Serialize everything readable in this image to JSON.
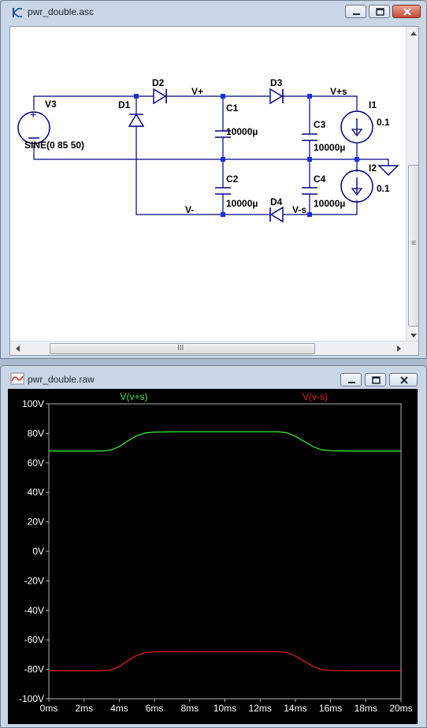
{
  "schematic_window": {
    "title": "pwr_double.asc",
    "controls": {
      "minimize": "minimize",
      "restore": "restore",
      "close": "close"
    },
    "labels": {
      "v3": "V3",
      "v3_value": "SINE(0 85 50)",
      "d1": "D1",
      "d2": "D2",
      "d3": "D3",
      "d4": "D4",
      "net_vplus": "V+",
      "net_vminus": "V-",
      "net_vplus_s": "V+s",
      "net_vminus_s": "V-s",
      "c1": "C1",
      "c1_value": "10000µ",
      "c2": "C2",
      "c2_value": "10000µ",
      "c3": "C3",
      "c3_value": "10000µ",
      "c4": "C4",
      "c4_value": "10000µ",
      "i1": "I1",
      "i1_value": "0.1",
      "i2": "I2",
      "i2_value": "0.1"
    },
    "hscroll_grip": "III",
    "vscroll_grip": "≡"
  },
  "waveform_window": {
    "title": "pwr_double.raw",
    "controls": {
      "minimize": "minimize",
      "restore": "restore",
      "close": "close"
    }
  },
  "chart_data": {
    "type": "line",
    "title": "",
    "xlabel": "",
    "ylabel": "",
    "xlim": [
      0,
      20
    ],
    "ylim": [
      -100,
      100
    ],
    "x_ticks": [
      "0ms",
      "2ms",
      "4ms",
      "6ms",
      "8ms",
      "10ms",
      "12ms",
      "14ms",
      "16ms",
      "18ms",
      "20ms"
    ],
    "y_ticks": [
      "100V",
      "80V",
      "60V",
      "40V",
      "20V",
      "0V",
      "-20V",
      "-40V",
      "-60V",
      "-80V",
      "-100V"
    ],
    "background": "#000000",
    "grid": false,
    "x": [
      0,
      1,
      2,
      3,
      3.5,
      4,
      4.5,
      5,
      5.5,
      6,
      7,
      8,
      9,
      10,
      11,
      12,
      13,
      13.5,
      14,
      14.5,
      15,
      15.5,
      16,
      17,
      18,
      19,
      20
    ],
    "series": [
      {
        "name": "V(v+s)",
        "color": "#39e639",
        "values": [
          68,
          68,
          68,
          68,
          68.5,
          71,
          75,
          78.5,
          80.3,
          80.8,
          81,
          81,
          81,
          81,
          81,
          81,
          81,
          80.5,
          78,
          74.5,
          71,
          68.8,
          68.2,
          68,
          68,
          68,
          68
        ]
      },
      {
        "name": "V(v-s)",
        "color": "#e02020",
        "values": [
          -81,
          -81,
          -81,
          -81,
          -80.5,
          -78,
          -74,
          -70.5,
          -68.7,
          -68.2,
          -68,
          -68,
          -68,
          -68,
          -68,
          -68,
          -68,
          -68.5,
          -71,
          -74.5,
          -78,
          -80.2,
          -80.8,
          -81,
          -81,
          -81,
          -81
        ]
      }
    ]
  }
}
